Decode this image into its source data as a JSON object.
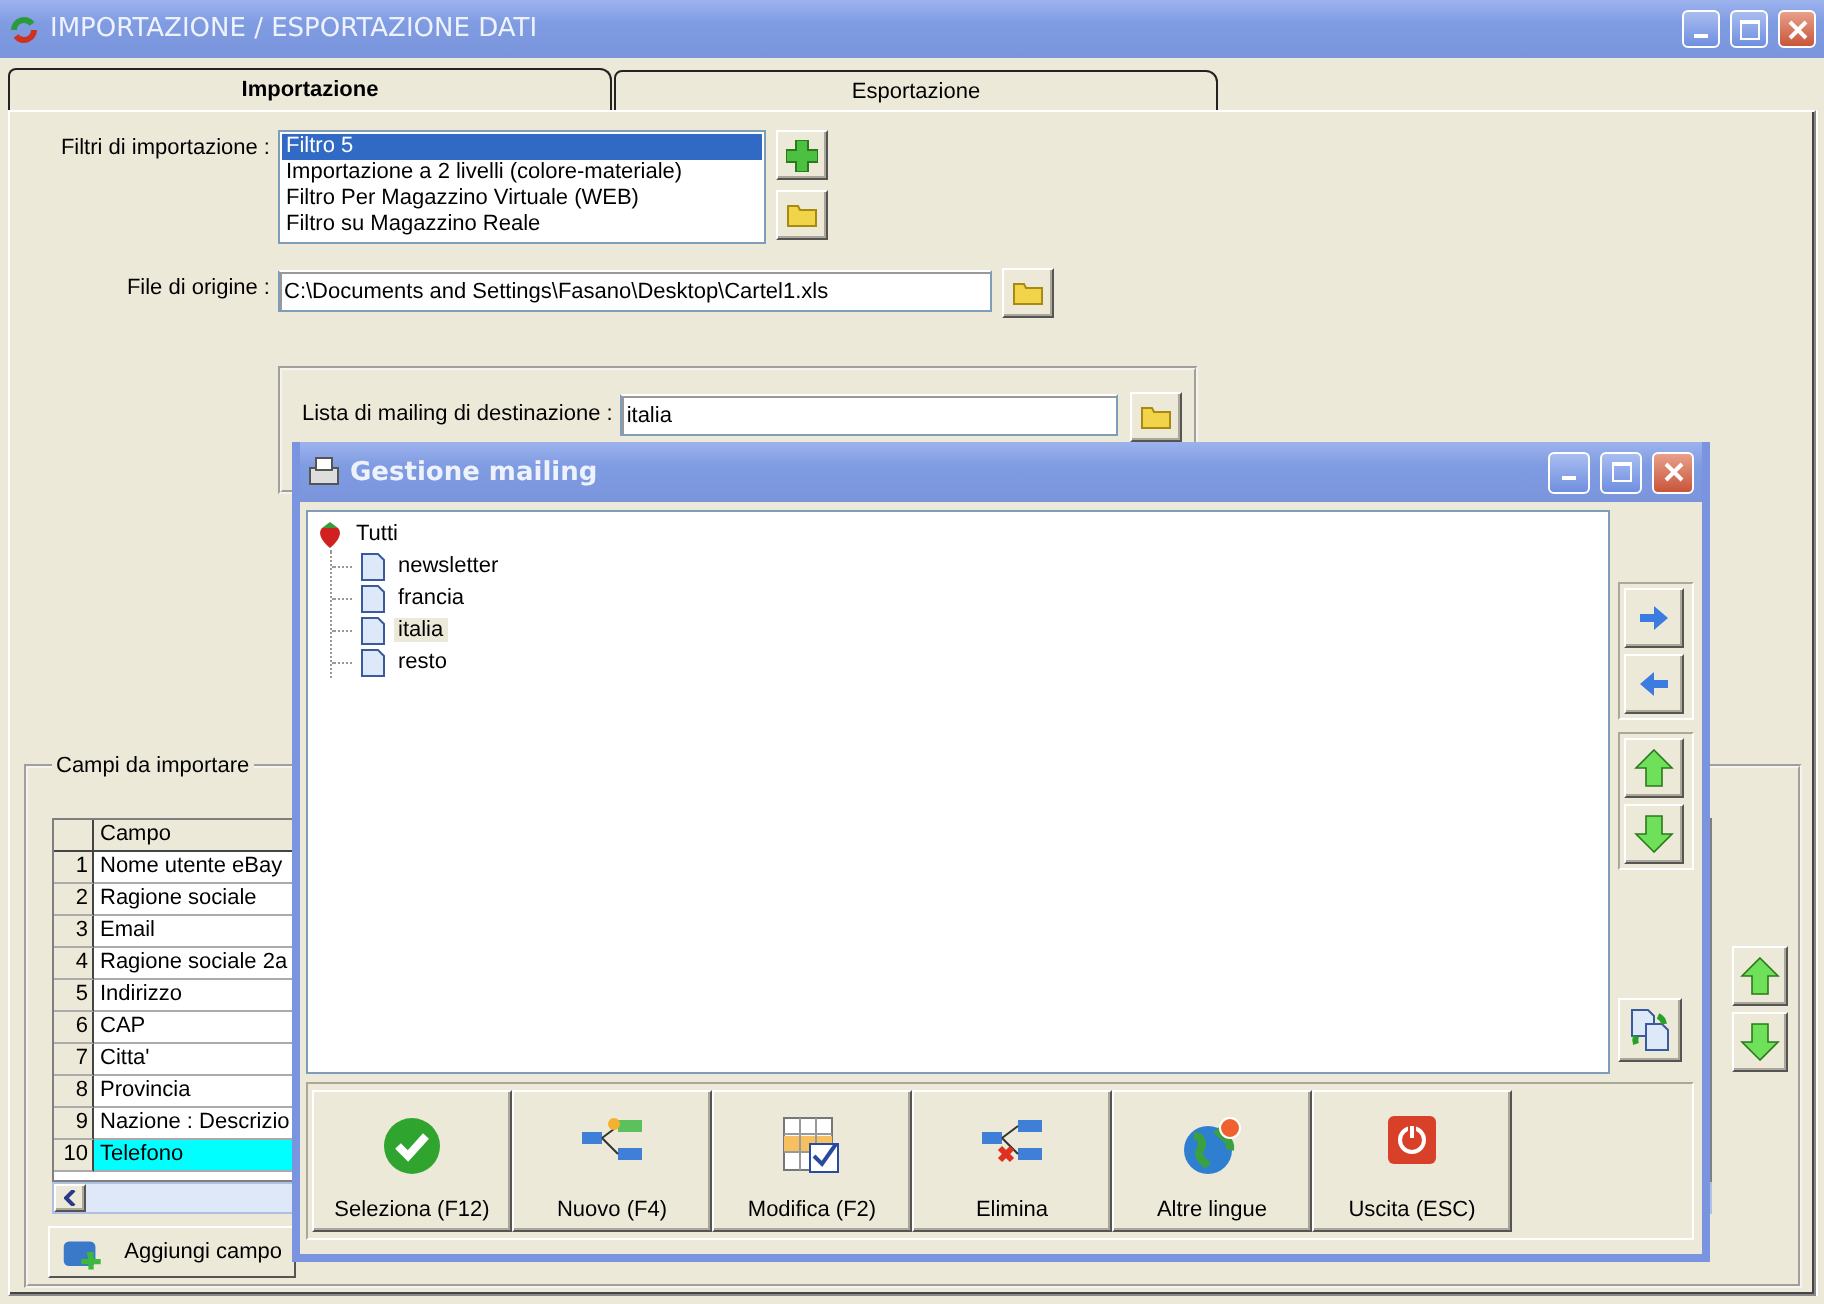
{
  "window": {
    "title": "IMPORTAZIONE / ESPORTAZIONE DATI"
  },
  "tabs": [
    {
      "label": "Importazione",
      "selected": true
    },
    {
      "label": "Esportazione",
      "selected": false
    }
  ],
  "filters": {
    "label": "Filtri di importazione :",
    "items": [
      {
        "label": "Filtro 5",
        "selected": true
      },
      {
        "label": "Importazione a 2 livelli (colore-materiale)",
        "selected": false
      },
      {
        "label": "Filtro Per Magazzino Virtuale (WEB)",
        "selected": false
      },
      {
        "label": "Filtro su Magazzino Reale",
        "selected": false
      }
    ]
  },
  "source_file": {
    "label": "File di origine :",
    "value": "C:\\Documents and Settings\\Fasano\\Desktop\\Cartel1.xls"
  },
  "mailing_list": {
    "label": "Lista di mailing di destinazione :",
    "value": "italia"
  },
  "fields_group": {
    "title": "Campi da importare",
    "columns": [
      "Campo"
    ],
    "rows": [
      {
        "number": "1",
        "field": "Nome utente eBay",
        "selected": false
      },
      {
        "number": "2",
        "field": "Ragione sociale",
        "selected": false
      },
      {
        "number": "3",
        "field": "Email",
        "selected": false
      },
      {
        "number": "4",
        "field": "Ragione sociale 2a",
        "selected": false
      },
      {
        "number": "5",
        "field": "Indirizzo",
        "selected": false
      },
      {
        "number": "6",
        "field": "CAP",
        "selected": false
      },
      {
        "number": "7",
        "field": "Citta'",
        "selected": false
      },
      {
        "number": "8",
        "field": "Provincia",
        "selected": false
      },
      {
        "number": "9",
        "field": "Nazione : Descrizio",
        "selected": false
      },
      {
        "number": "10",
        "field": "Telefono",
        "selected": true
      }
    ],
    "add_button": "Aggiungi campo"
  },
  "dialog": {
    "title": "Gestione mailing",
    "tree": {
      "label": "Tutti",
      "children": [
        {
          "label": "newsletter",
          "selected": false
        },
        {
          "label": "francia",
          "selected": false
        },
        {
          "label": "italia",
          "selected": true
        },
        {
          "label": "resto",
          "selected": false
        }
      ]
    },
    "buttons": [
      {
        "label": "Seleziona (F12)",
        "kind": "select"
      },
      {
        "label": "Nuovo (F4)",
        "kind": "new"
      },
      {
        "label": "Modifica (F2)",
        "kind": "edit"
      },
      {
        "label": "Elimina",
        "kind": "delete"
      },
      {
        "label": "Altre lingue",
        "kind": "languages"
      },
      {
        "label": "Uscita (ESC)",
        "kind": "exit"
      }
    ]
  }
}
